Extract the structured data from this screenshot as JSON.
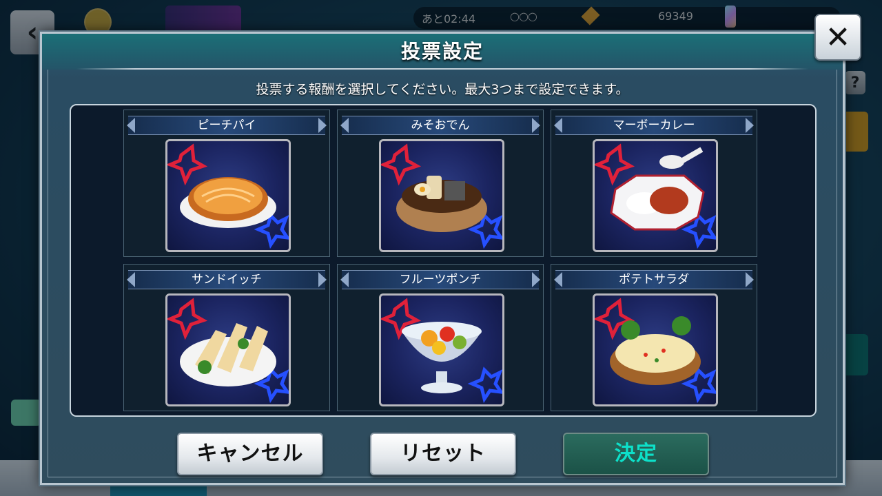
{
  "background": {
    "timer": "あと02:44",
    "dots": "○○○",
    "coins": "69349",
    "help": "?",
    "back": "‹"
  },
  "modal": {
    "title": "投票設定",
    "instruction": "投票する報酬を選択してください。最大3つまで設定できます。",
    "close": "✕"
  },
  "rewards": [
    {
      "name": "ピーチパイ",
      "icon": "peach-pie-icon"
    },
    {
      "name": "みそおでん",
      "icon": "miso-oden-icon"
    },
    {
      "name": "マーボーカレー",
      "icon": "mapo-curry-icon"
    },
    {
      "name": "サンドイッチ",
      "icon": "sandwich-icon"
    },
    {
      "name": "フルーツポンチ",
      "icon": "fruit-punch-icon"
    },
    {
      "name": "ポテトサラダ",
      "icon": "potato-salad-icon"
    }
  ],
  "buttons": {
    "cancel": "キャンセル",
    "reset": "リセット",
    "confirm": "決定"
  }
}
